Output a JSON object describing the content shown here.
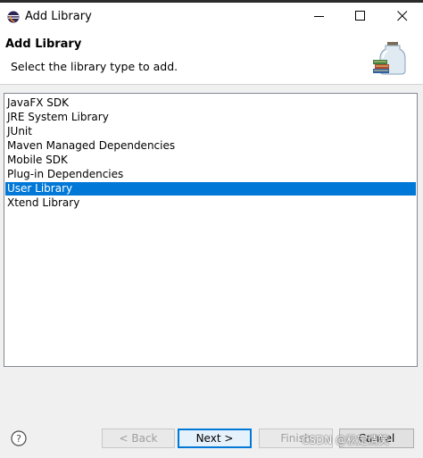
{
  "window": {
    "title": "Add Library",
    "controls": [
      "minimize-icon",
      "maximize-icon",
      "close-icon"
    ]
  },
  "header": {
    "title": "Add Library",
    "description": "Select the library type to add."
  },
  "library_types": [
    {
      "label": "JavaFX SDK",
      "selected": false
    },
    {
      "label": "JRE System Library",
      "selected": false
    },
    {
      "label": "JUnit",
      "selected": false
    },
    {
      "label": "Maven Managed Dependencies",
      "selected": false
    },
    {
      "label": "Mobile SDK",
      "selected": false
    },
    {
      "label": "Plug-in Dependencies",
      "selected": false
    },
    {
      "label": "User Library",
      "selected": true
    },
    {
      "label": "Xtend Library",
      "selected": false
    }
  ],
  "buttons": {
    "back": "< Back",
    "next": "Next >",
    "finish": "Finish",
    "cancel": "Cancel"
  },
  "watermark": "CSDN @秋定情笑",
  "colors": {
    "selection": "#0078d7",
    "default_button_border": "#0078d7",
    "dialog_background": "#f0f0f0"
  }
}
